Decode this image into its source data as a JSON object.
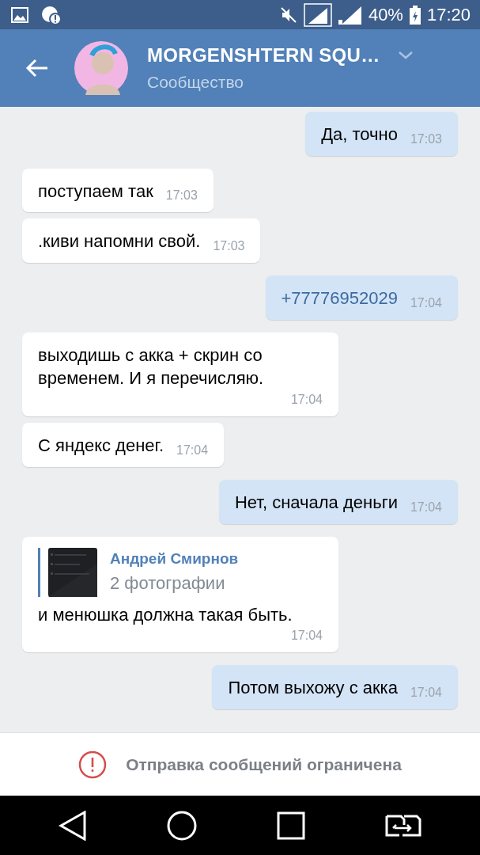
{
  "status_bar": {
    "battery": "40%",
    "time": "17:20"
  },
  "header": {
    "title": "MORGENSHTERN SQU…",
    "subtitle": "Сообщество"
  },
  "messages": [
    {
      "kind": "outgoing",
      "text": "Да, точно",
      "time": "17:03"
    },
    {
      "kind": "incoming",
      "text": "поступаем так",
      "time": "17:03"
    },
    {
      "kind": "incoming",
      "text": ".киви напомни свой.",
      "time": "17:03"
    },
    {
      "kind": "outgoing",
      "text": "+77776952029",
      "time": "17:04",
      "link": true
    },
    {
      "kind": "incoming",
      "text": "выходишь с акка + скрин со временем. И я перечисляю.",
      "time": "17:04"
    },
    {
      "kind": "incoming",
      "text": "С яндекс денег.",
      "time": "17:04"
    },
    {
      "kind": "outgoing",
      "text": "Нет, сначала деньги",
      "time": "17:04"
    },
    {
      "kind": "incoming",
      "text": "и менюшка должна такая быть.",
      "time": "17:04",
      "reply": {
        "author": "Андрей Смирнов",
        "attachment": "2 фотографии"
      }
    },
    {
      "kind": "outgoing",
      "text": "Потом выхожу с акка",
      "time": "17:04"
    }
  ],
  "footer": {
    "notice": "Отправка сообщений ограничена"
  }
}
